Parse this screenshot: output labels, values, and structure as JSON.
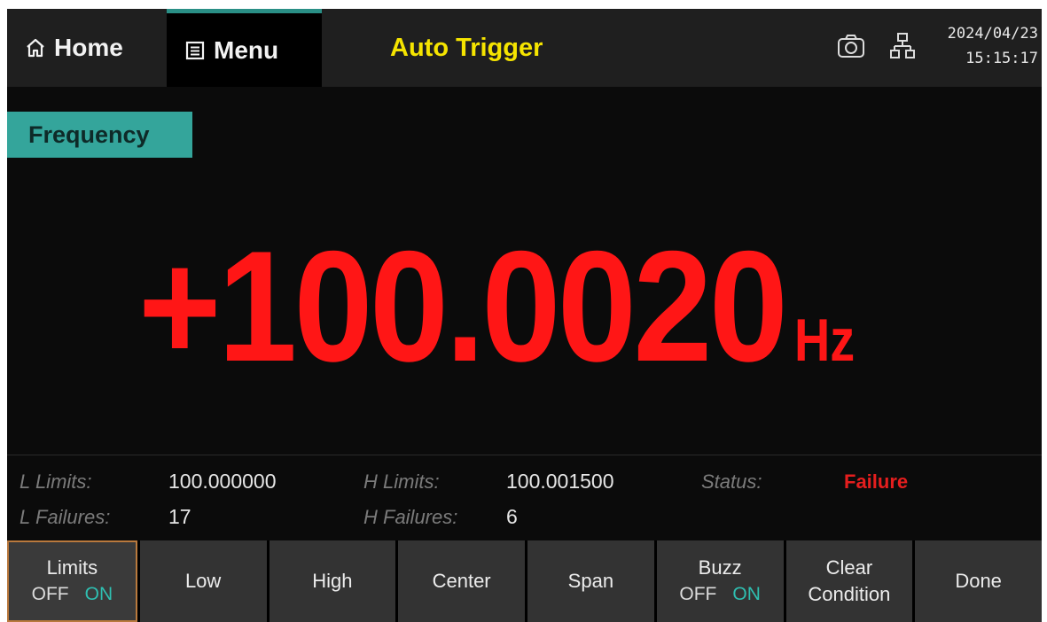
{
  "topbar": {
    "home_label": "Home",
    "menu_label": "Menu",
    "trigger_title": "Auto Trigger",
    "date": "2024/04/23",
    "time": "15:15:17",
    "icons": [
      "home-icon",
      "menu-icon",
      "camera-icon",
      "network-icon"
    ]
  },
  "function_label": "Frequency",
  "reading": {
    "value": "+100.0020",
    "unit": "Hz",
    "color": "#ff1616"
  },
  "stats": {
    "l_limits_label": "L Limits:",
    "l_limits_value": "100.000000",
    "h_limits_label": "H Limits:",
    "h_limits_value": "100.001500",
    "status_label": "Status:",
    "status_value": "Failure",
    "l_failures_label": "L Failures:",
    "l_failures_value": "17",
    "h_failures_label": "H Failures:",
    "h_failures_value": "6"
  },
  "softkeys": {
    "limits": {
      "label": "Limits",
      "off": "OFF",
      "on": "ON",
      "state": "ON"
    },
    "low": "Low",
    "high": "High",
    "center": "Center",
    "span": "Span",
    "buzz": {
      "label": "Buzz",
      "off": "OFF",
      "on": "ON",
      "state": "ON"
    },
    "clear_line1": "Clear",
    "clear_line2": "Condition",
    "done": "Done"
  },
  "colors": {
    "accent_teal": "#34a59b",
    "trigger_yellow": "#f5e400",
    "failure_red": "#e51e1e"
  }
}
